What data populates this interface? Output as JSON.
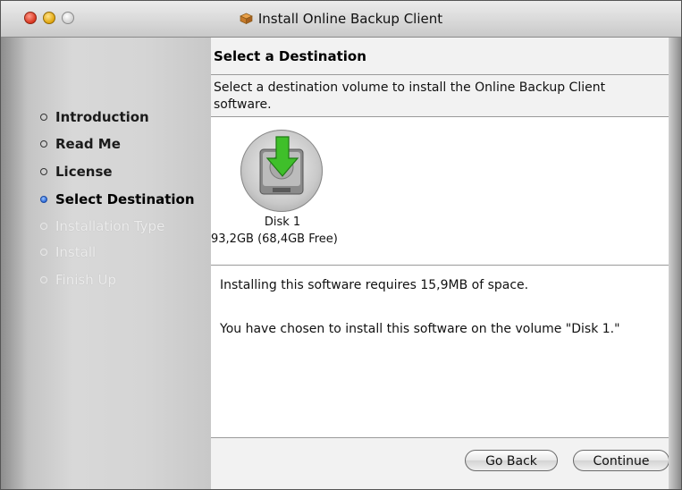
{
  "window": {
    "title": "Install Online Backup Client",
    "traffic_lights": [
      "close",
      "minimize",
      "zoom"
    ]
  },
  "sidebar": {
    "steps": [
      {
        "label": "Introduction",
        "state": "done"
      },
      {
        "label": "Read Me",
        "state": "done"
      },
      {
        "label": "License",
        "state": "done"
      },
      {
        "label": "Select Destination",
        "state": "current"
      },
      {
        "label": "Installation Type",
        "state": "future"
      },
      {
        "label": "Install",
        "state": "future"
      },
      {
        "label": "Finish Up",
        "state": "future"
      }
    ]
  },
  "main": {
    "heading": "Select a Destination",
    "instructions": "Select a destination volume to install the Online Backup Client software.",
    "volume": {
      "icon": "hard-disk-install-icon",
      "name": "Disk 1",
      "size": "93,2GB (68,4GB Free)"
    },
    "space_required": "Installing this software requires 15,9MB of space.",
    "chosen_volume": "You have chosen to install this software on the volume \"Disk 1.\""
  },
  "buttons": {
    "back": "Go Back",
    "continue": "Continue"
  },
  "colors": {
    "current_step_dot": "#2c6ad8",
    "install_arrow": "#3fbf2a"
  }
}
